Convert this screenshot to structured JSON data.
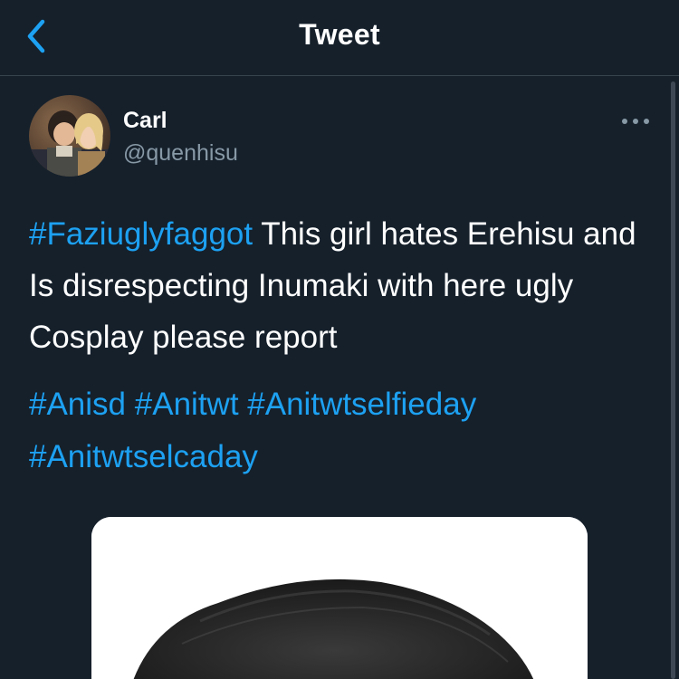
{
  "header": {
    "title": "Tweet",
    "back_icon": "chevron-left-icon",
    "accent_color": "#1da1f2"
  },
  "tweet": {
    "author": {
      "name": "Carl",
      "handle": "@quenhisu"
    },
    "more_icon": "more-horizontal-icon",
    "text": {
      "hashtag": "#Faziuglyfaggot",
      "body": " This girl hates Erehisu and Is disrespecting Inumaki with here ugly Cosplay please report"
    },
    "hashtags": [
      "#Anisd",
      "#Anitwt",
      "#Anitwtselfieday",
      "#Anitwtselcaday"
    ]
  },
  "colors": {
    "background": "#15202b",
    "text": "#ffffff",
    "secondary_text": "#8899a6",
    "link": "#1da1f2",
    "divider": "#38444d"
  }
}
